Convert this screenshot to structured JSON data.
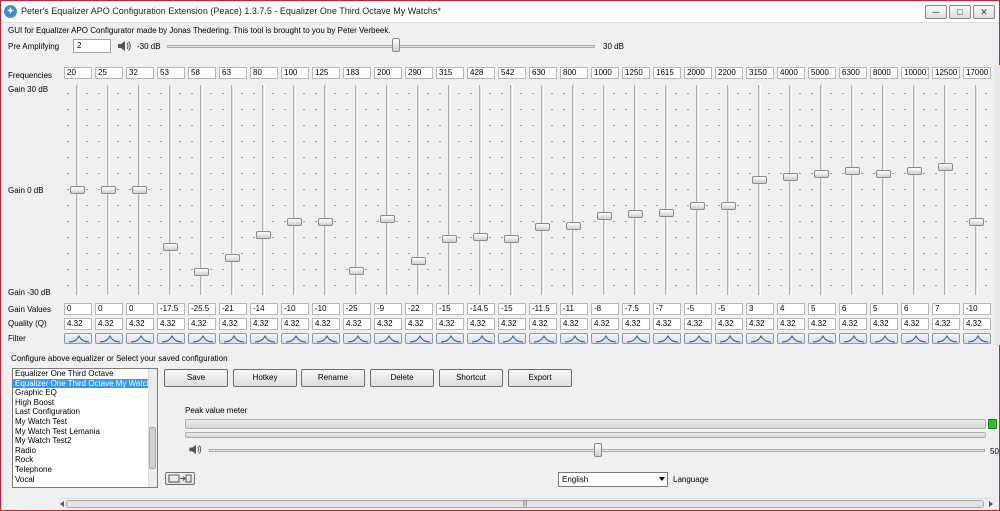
{
  "window": {
    "title": "Peter's Equalizer APO Configuration Extension (Peace) 1.3.7.5 - Equalizer One Third Octave My Watchs*",
    "controls": {
      "minimize": "─",
      "maximize": "□",
      "close": "✕"
    }
  },
  "subtitle": "GUI for Equalizer APO Configurator made by Jonas Thedering. This tool is brought to you by Peter Verbeek.",
  "pre_amp": {
    "label": "Pre Amplifying",
    "value": "2",
    "min_label": "-30 dB",
    "max_label": "30 dB",
    "level_db": 2
  },
  "rows": {
    "frequencies": "Frequencies",
    "gain_top": "Gain 30 dB",
    "gain_mid": "Gain 0 dB",
    "gain_bottom": "Gain -30 dB",
    "gain_values": "Gain Values",
    "quality": "Quality (Q)",
    "filter": "Filter"
  },
  "bands": [
    {
      "freq": "20",
      "gain": "0",
      "q": "4.32"
    },
    {
      "freq": "25",
      "gain": "0",
      "q": "4.32"
    },
    {
      "freq": "32",
      "gain": "0",
      "q": "4.32"
    },
    {
      "freq": "53",
      "gain": "-17.5",
      "q": "4.32"
    },
    {
      "freq": "58",
      "gain": "-25.5",
      "q": "4.32"
    },
    {
      "freq": "63",
      "gain": "-21",
      "q": "4.32"
    },
    {
      "freq": "80",
      "gain": "-14",
      "q": "4.32"
    },
    {
      "freq": "100",
      "gain": "-10",
      "q": "4.32"
    },
    {
      "freq": "125",
      "gain": "-10",
      "q": "4.32"
    },
    {
      "freq": "183",
      "gain": "-25",
      "q": "4.32"
    },
    {
      "freq": "200",
      "gain": "-9",
      "q": "4.32"
    },
    {
      "freq": "290",
      "gain": "-22",
      "q": "4.32"
    },
    {
      "freq": "315",
      "gain": "-15",
      "q": "4.32"
    },
    {
      "freq": "428",
      "gain": "-14.5",
      "q": "4.32"
    },
    {
      "freq": "542",
      "gain": "-15",
      "q": "4.32"
    },
    {
      "freq": "630",
      "gain": "-11.5",
      "q": "4.32"
    },
    {
      "freq": "800",
      "gain": "-11",
      "q": "4.32"
    },
    {
      "freq": "1000",
      "gain": "-8",
      "q": "4.32"
    },
    {
      "freq": "1250",
      "gain": "-7.5",
      "q": "4.32"
    },
    {
      "freq": "1615",
      "gain": "-7",
      "q": "4.32"
    },
    {
      "freq": "2000",
      "gain": "-5",
      "q": "4.32"
    },
    {
      "freq": "2200",
      "gain": "-5",
      "q": "4.32"
    },
    {
      "freq": "3150",
      "gain": "3",
      "q": "4.32"
    },
    {
      "freq": "4000",
      "gain": "4",
      "q": "4.32"
    },
    {
      "freq": "5000",
      "gain": "5",
      "q": "4.32"
    },
    {
      "freq": "6300",
      "gain": "6",
      "q": "4.32"
    },
    {
      "freq": "8000",
      "gain": "5",
      "q": "4.32"
    },
    {
      "freq": "10000",
      "gain": "6",
      "q": "4.32"
    },
    {
      "freq": "12500",
      "gain": "7",
      "q": "4.32"
    },
    {
      "freq": "17000",
      "gain": "-10",
      "q": "4.32"
    }
  ],
  "config": {
    "label": "Configure above equalizer or Select your saved configuration",
    "items": [
      {
        "label": "Equalizer One Third Octave",
        "selected": false
      },
      {
        "label": "Equalizer One Third Octave My Watchs",
        "selected": true
      },
      {
        "label": "Graphic EQ",
        "selected": false
      },
      {
        "label": "High Boost",
        "selected": false
      },
      {
        "label": "Last Configuration",
        "selected": false
      },
      {
        "label": "My Watch Test",
        "selected": false
      },
      {
        "label": "My Watch Test Lemania",
        "selected": false
      },
      {
        "label": "My Watch Test2",
        "selected": false
      },
      {
        "label": "Radio",
        "selected": false
      },
      {
        "label": "Rock",
        "selected": false
      },
      {
        "label": "Telephone",
        "selected": false
      },
      {
        "label": "Vocal",
        "selected": false
      }
    ],
    "buttons": {
      "save": "Save",
      "hotkey": "Hotkey",
      "rename": "Rename",
      "delete": "Delete",
      "shortcut": "Shortcut",
      "export": "Export"
    }
  },
  "peak_meter": {
    "label": "Peak value meter"
  },
  "volume": {
    "value": "50"
  },
  "language": {
    "selected": "English",
    "label": "Language"
  },
  "scrollbar": {
    "grip": "|||"
  },
  "colors": {
    "selection": "#3399ff",
    "peak_green": "#26c22e",
    "title_border": "#c0282f"
  }
}
